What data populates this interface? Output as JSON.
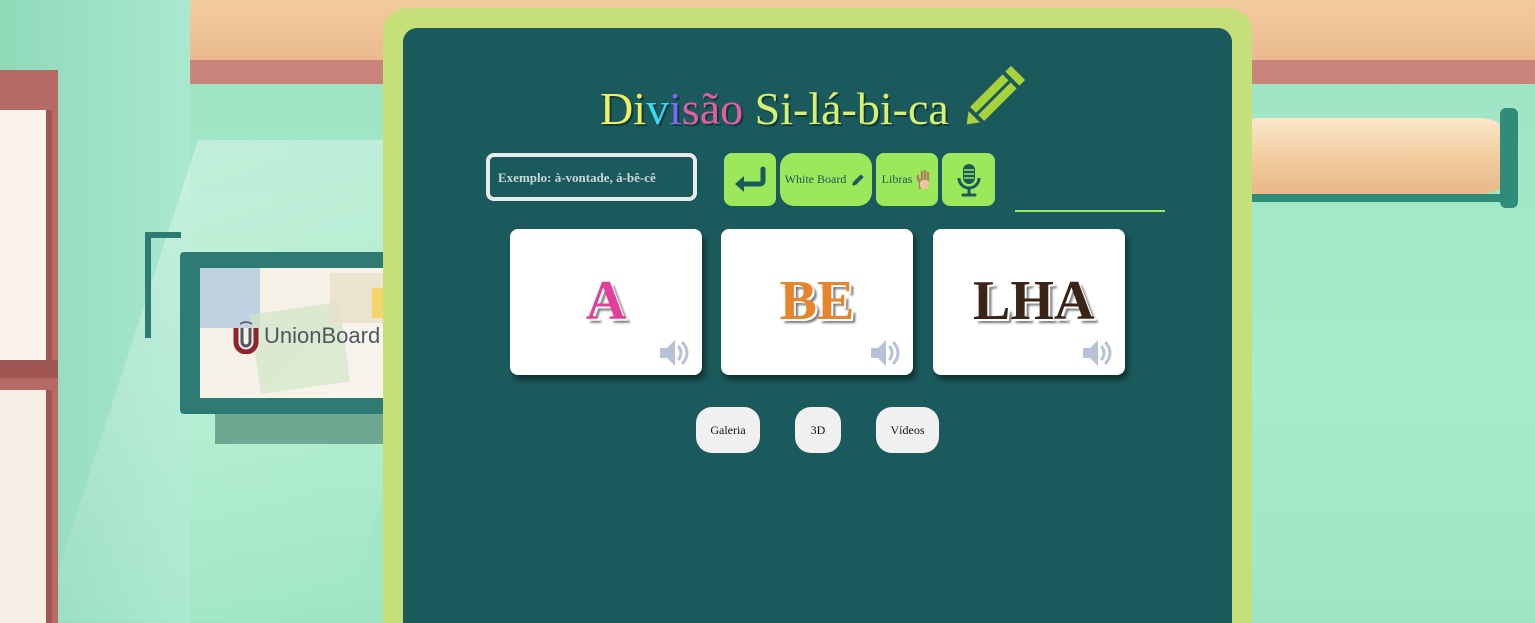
{
  "background": {
    "tv_logo_text": "UnionBoard"
  },
  "title": {
    "letters": [
      {
        "char": "D",
        "color": "#f0f060"
      },
      {
        "char": "i",
        "color": "#f0f060"
      },
      {
        "char": "v",
        "color": "#3bd6f0"
      },
      {
        "char": "i",
        "color": "#7a6cf2"
      },
      {
        "char": "s",
        "color": "#e55ca0"
      },
      {
        "char": "ã",
        "color": "#e55ca0"
      },
      {
        "char": "o",
        "color": "#e55ca0"
      },
      {
        "char": " ",
        "color": "#ffffff"
      },
      {
        "char": "S",
        "color": "#d8f070"
      },
      {
        "char": "i",
        "color": "#d8f070"
      },
      {
        "char": "-",
        "color": "#d8f070"
      },
      {
        "char": "l",
        "color": "#d8f070"
      },
      {
        "char": "á",
        "color": "#d8f070"
      },
      {
        "char": "-",
        "color": "#d8f070"
      },
      {
        "char": "b",
        "color": "#d8f070"
      },
      {
        "char": "i",
        "color": "#d8f070"
      },
      {
        "char": "-",
        "color": "#d8f070"
      },
      {
        "char": "c",
        "color": "#d8f070"
      },
      {
        "char": "a",
        "color": "#d8f070"
      }
    ],
    "icon": "pencil-icon"
  },
  "search": {
    "placeholder": "Exemplo: à-vontade, á-bê-cê",
    "value": ""
  },
  "toolbar": {
    "enter_icon": "enter-arrow-icon",
    "whiteboard_label": "White Board",
    "whiteboard_icon": "pencil-icon",
    "libras_label": "Libras",
    "libras_icon": "hand-icon",
    "mic_icon": "microphone-icon"
  },
  "syllables": [
    {
      "text": "A",
      "color": "#e0409a",
      "icon": "speaker-icon"
    },
    {
      "text": "BE",
      "color": "#e8842a",
      "icon": "speaker-icon"
    },
    {
      "text": "LHA",
      "color": "#3a2418",
      "icon": "speaker-icon"
    }
  ],
  "bottom_buttons": {
    "galeria": "Galeria",
    "three_d": "3D",
    "videos": "Vídeos"
  },
  "colors": {
    "board": "#1b5a5c",
    "frame": "#c5e078",
    "button_green": "#9be85a"
  }
}
